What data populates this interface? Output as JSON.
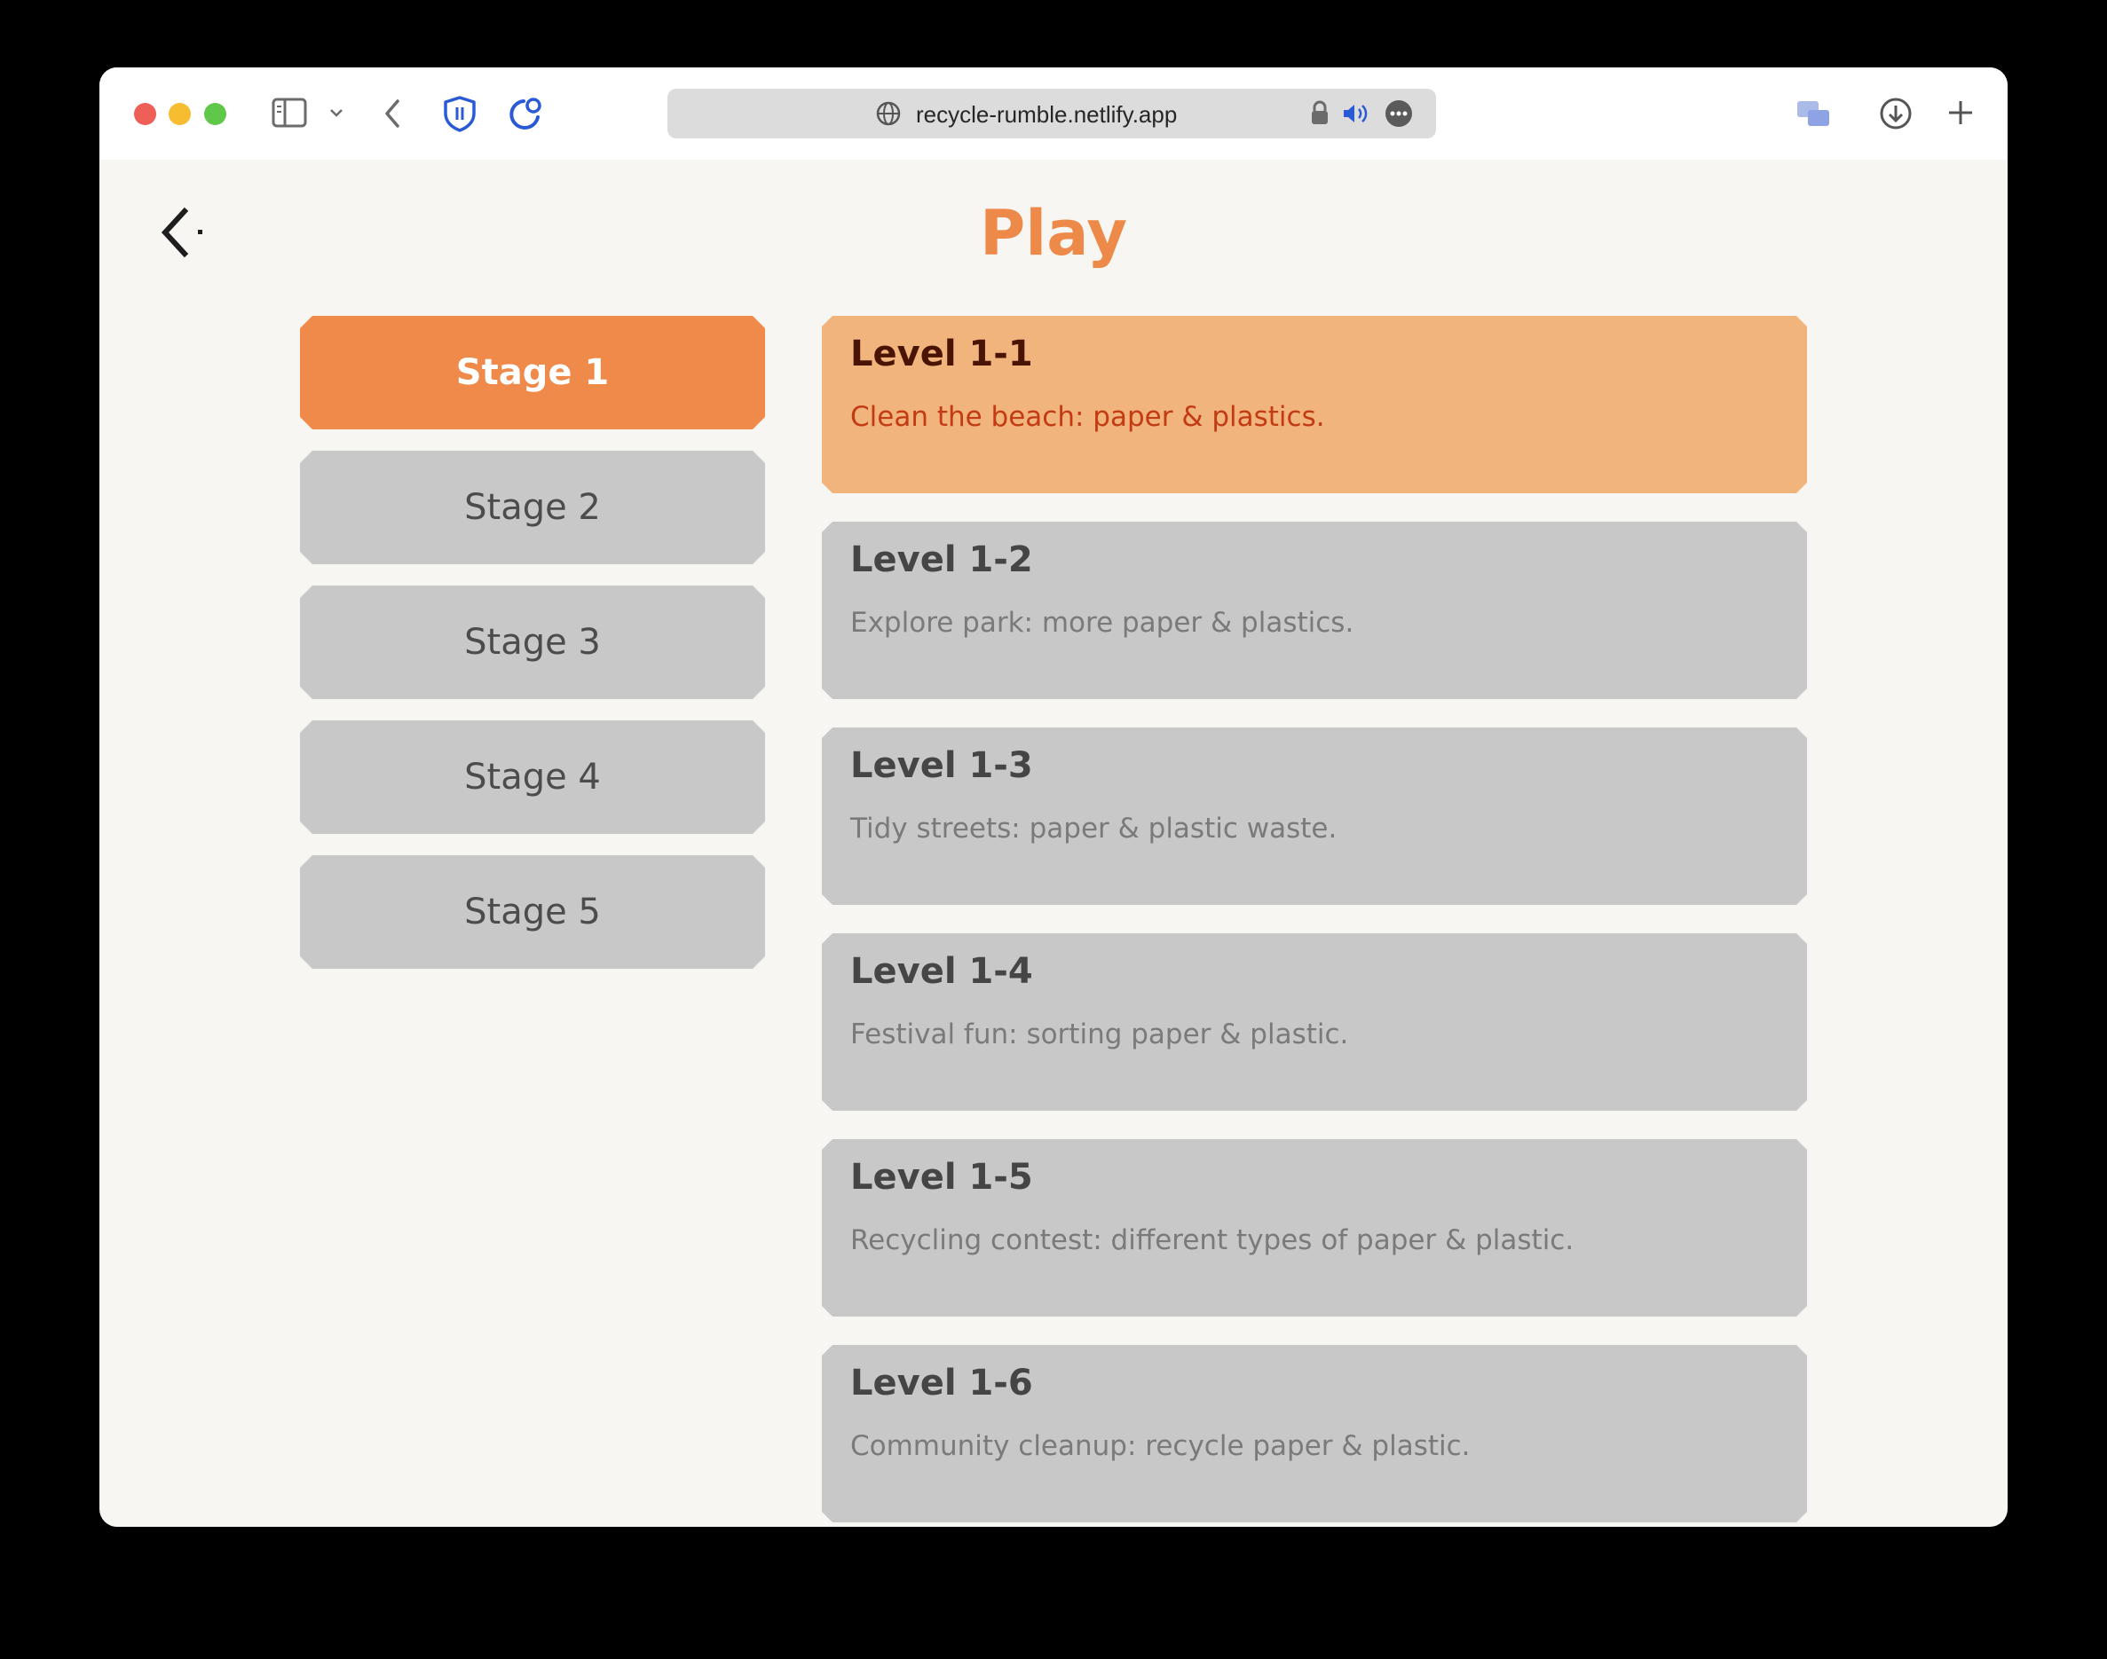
{
  "browser": {
    "url": "recycle-rumble.netlify.app"
  },
  "page": {
    "title": "Play"
  },
  "stages": [
    {
      "label": "Stage 1",
      "active": true
    },
    {
      "label": "Stage 2",
      "active": false
    },
    {
      "label": "Stage 3",
      "active": false
    },
    {
      "label": "Stage 4",
      "active": false
    },
    {
      "label": "Stage 5",
      "active": false
    }
  ],
  "levels": [
    {
      "title": "Level 1-1",
      "description": "Clean the beach: paper & plastics.",
      "active": true
    },
    {
      "title": "Level 1-2",
      "description": "Explore park: more paper & plastics.",
      "active": false
    },
    {
      "title": "Level 1-3",
      "description": "Tidy streets: paper & plastic waste.",
      "active": false
    },
    {
      "title": "Level 1-4",
      "description": "Festival fun: sorting paper & plastic.",
      "active": false
    },
    {
      "title": "Level 1-5",
      "description": "Recycling contest: different types of paper & plastic.",
      "active": false
    },
    {
      "title": "Level 1-6",
      "description": "Community cleanup: recycle paper & plastic.",
      "active": false
    }
  ],
  "colors": {
    "accent": "#ef8a4b",
    "active_card": "#f2b47d",
    "inactive": "#c8c8c8",
    "background": "#f7f6f3"
  },
  "icons": {
    "back": "back-arrow-icon",
    "sidebar": "sidebar-icon",
    "shield": "shield-icon",
    "globe": "globe-icon",
    "lock": "lock-icon",
    "speaker": "speaker-icon",
    "more": "more-icon",
    "download": "download-icon",
    "new_tab": "plus-icon"
  }
}
